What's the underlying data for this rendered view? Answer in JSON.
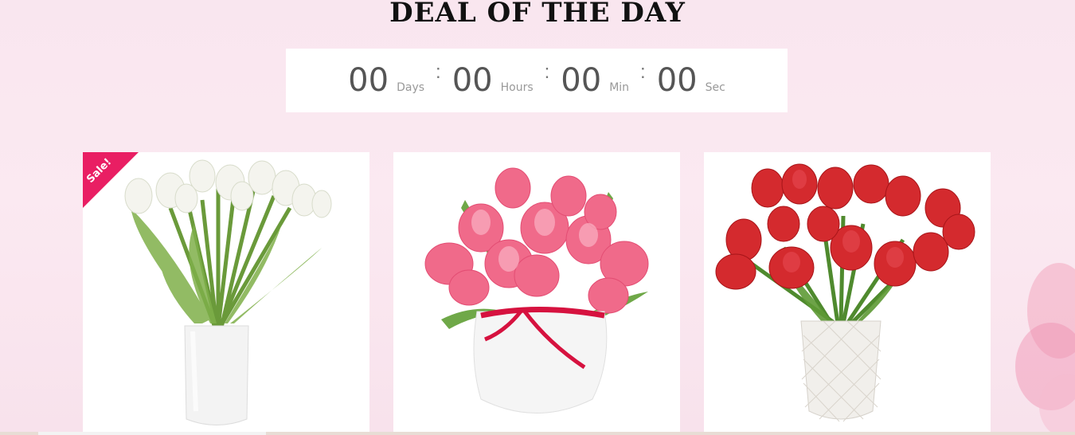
{
  "section": {
    "title": "DEAL OF THE DAY"
  },
  "countdown": {
    "days": {
      "value": "00",
      "label": "Days"
    },
    "hours": {
      "value": "00",
      "label": "Hours"
    },
    "minutes": {
      "value": "00",
      "label": "Min"
    },
    "seconds": {
      "value": "00",
      "label": "Sec"
    },
    "separator": ":"
  },
  "products": [
    {
      "image": "white-tulips-vase",
      "badge": "Sale!"
    },
    {
      "image": "pink-tulips-vase"
    },
    {
      "image": "red-tulips-vase"
    }
  ],
  "colors": {
    "background": "#fbe9f1",
    "sale_badge": "#e91e63",
    "countdown_number": "#555555",
    "countdown_label": "#999999"
  }
}
